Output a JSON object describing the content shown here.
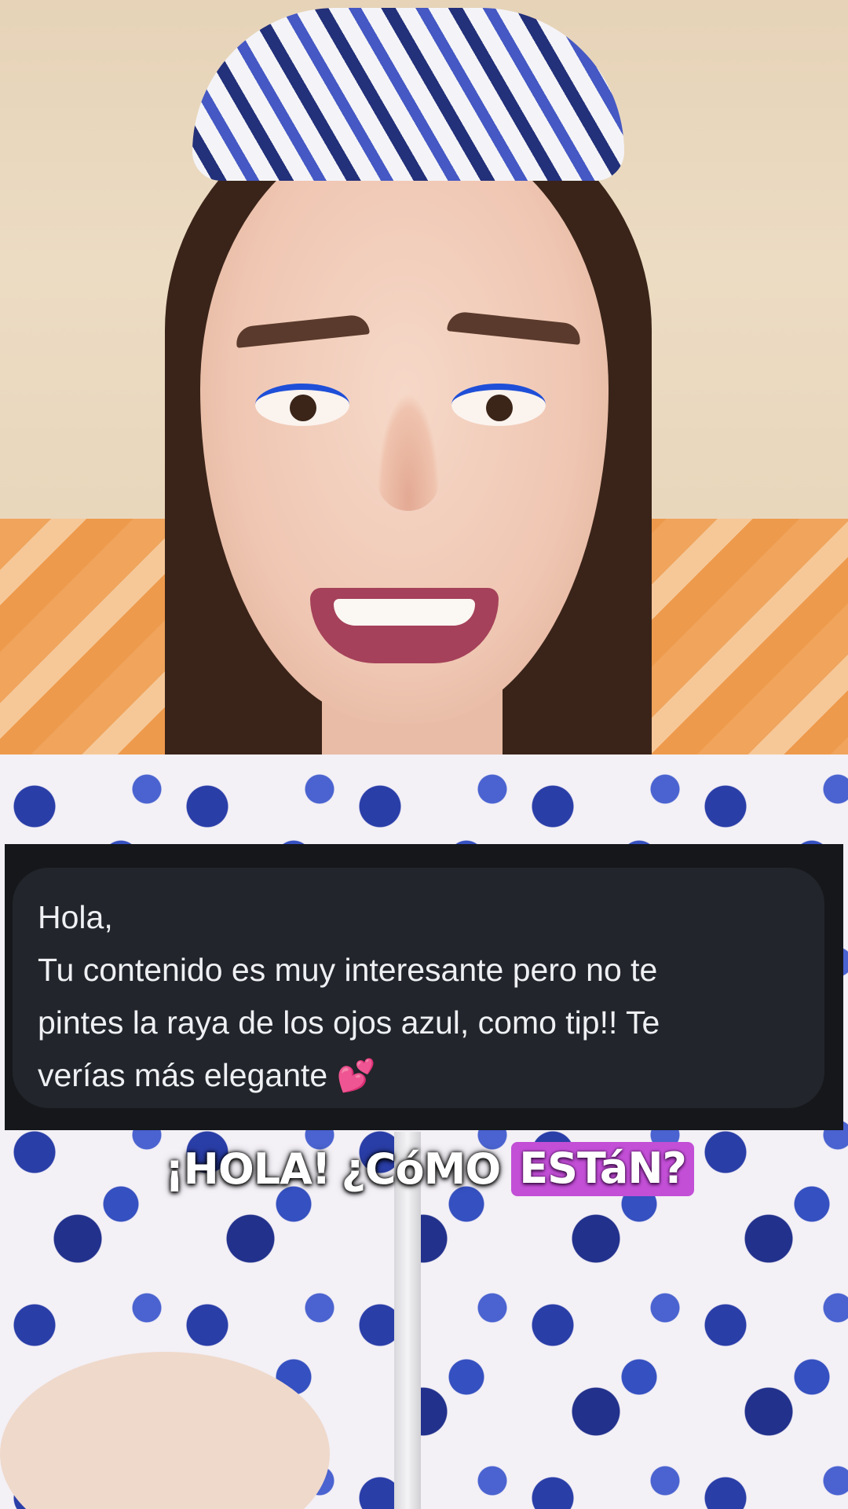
{
  "message": {
    "lines": [
      "Hola,",
      "Tu contenido es muy interesante pero no te",
      "pintes la raya de los ojos azul, como tip!! Te",
      "verías más elegante"
    ],
    "emoji": "💕"
  },
  "caption": {
    "part1": "¡HOLA!",
    "part2": "¿CóMO",
    "highlight": "ESTáN?"
  },
  "colors": {
    "caption_highlight": "#c24fd6",
    "bubble": "#22252b",
    "eyeliner": "#1f4fd8"
  }
}
